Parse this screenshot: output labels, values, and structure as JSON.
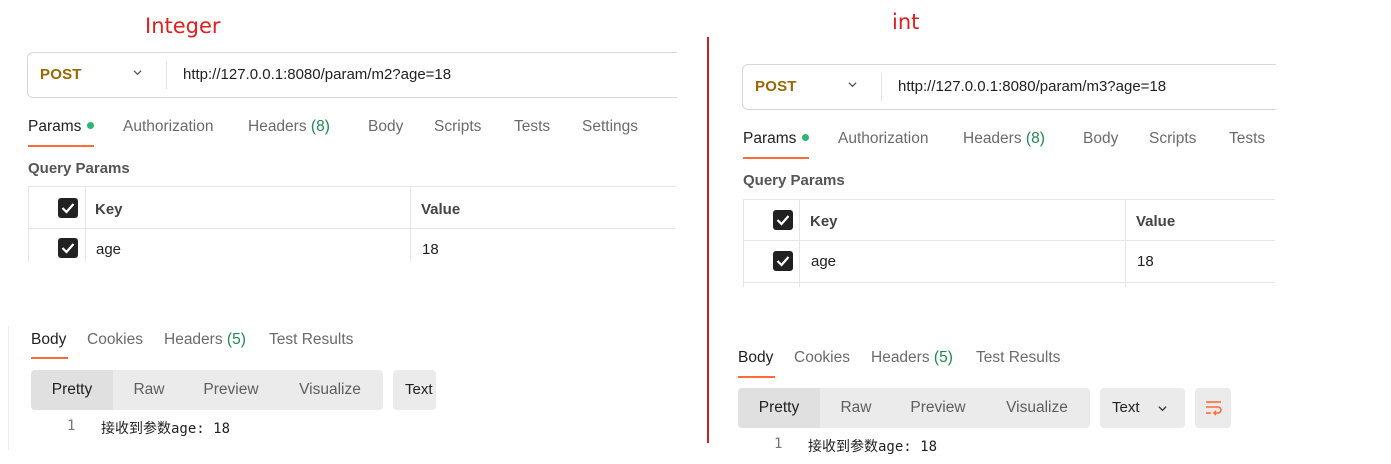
{
  "annotations": {
    "left": "Integer",
    "right": "int"
  },
  "left_panel": {
    "method": "POST",
    "url": "http://127.0.0.1:8080/param/m2?age=18",
    "request_tabs": [
      "Params",
      "Authorization",
      "Headers",
      "(8)",
      "Body",
      "Scripts",
      "Tests",
      "Settings"
    ],
    "query_params_title": "Query Params",
    "table": {
      "key_header": "Key",
      "value_header": "Value",
      "rows": [
        {
          "key": "age",
          "value": "18"
        }
      ]
    },
    "response_tabs": [
      "Body",
      "Cookies",
      "Headers",
      "(5)",
      "Test Results"
    ],
    "view_modes": [
      "Pretty",
      "Raw",
      "Preview",
      "Visualize"
    ],
    "format": "Text",
    "response_lines": [
      {
        "no": "1",
        "text": "接收到参数age: 18"
      }
    ]
  },
  "right_panel": {
    "method": "POST",
    "url": "http://127.0.0.1:8080/param/m3?age=18",
    "request_tabs": [
      "Params",
      "Authorization",
      "Headers",
      "(8)",
      "Body",
      "Scripts",
      "Tests"
    ],
    "query_params_title": "Query Params",
    "table": {
      "key_header": "Key",
      "value_header": "Value",
      "rows": [
        {
          "key": "age",
          "value": "18"
        }
      ]
    },
    "response_tabs": [
      "Body",
      "Cookies",
      "Headers",
      "(5)",
      "Test Results"
    ],
    "view_modes": [
      "Pretty",
      "Raw",
      "Preview",
      "Visualize"
    ],
    "format": "Text",
    "response_lines": [
      {
        "no": "1",
        "text": "接收到参数age: 18"
      }
    ]
  },
  "colors": {
    "annotation_red": "#e0201f",
    "method_post": "#9a6700",
    "tab_active_underline": "#ff6c37",
    "count_green": "#1d8a4e",
    "params_dot": "#2bb673"
  }
}
